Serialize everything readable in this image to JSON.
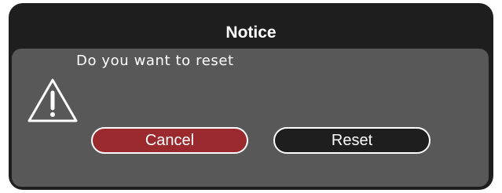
{
  "dialog": {
    "title": "Notice",
    "message": "Do you want to reset",
    "icon": "warning-triangle-icon",
    "buttons": {
      "cancel_label": "Cancel",
      "reset_label": "Reset"
    }
  },
  "colors": {
    "frame": "#1e1e1e",
    "panel": "#585858",
    "cancel_button": "#9b2a2e",
    "reset_button": "#1e1e1e",
    "text": "#ffffff"
  }
}
